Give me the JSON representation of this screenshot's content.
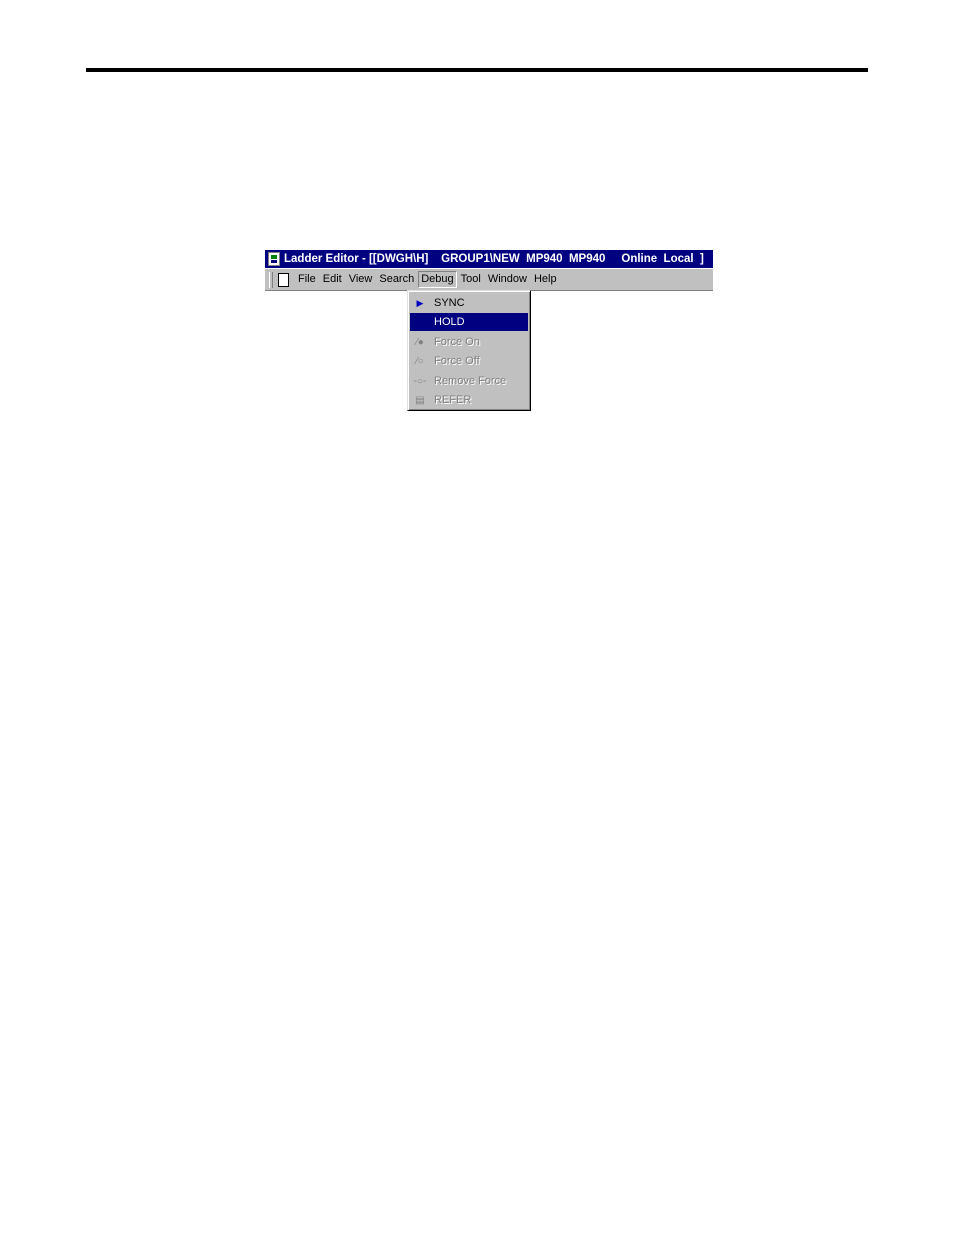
{
  "window": {
    "title": "Ladder Editor - [[DWGH\\H]    GROUP1\\NEW  MP940  MP940     Online  Local  ]"
  },
  "menubar": {
    "items": [
      {
        "label": "File"
      },
      {
        "label": "Edit"
      },
      {
        "label": "View"
      },
      {
        "label": "Search"
      },
      {
        "label": "Debug"
      },
      {
        "label": "Tool"
      },
      {
        "label": "Window"
      },
      {
        "label": "Help"
      }
    ]
  },
  "debug_menu": {
    "items": [
      {
        "label": "SYNC",
        "icon": "sync-icon",
        "state": "enabled"
      },
      {
        "label": "HOLD",
        "icon": "",
        "state": "selected"
      },
      {
        "label": "Force On",
        "icon": "force-on-icon",
        "state": "disabled"
      },
      {
        "label": "Force Off",
        "icon": "force-off-icon",
        "state": "disabled"
      },
      {
        "label": "Remove Force",
        "icon": "remove-force-icon",
        "state": "disabled"
      },
      {
        "label": "REFER",
        "icon": "refer-icon",
        "state": "disabled"
      }
    ]
  },
  "colors": {
    "titlebar": "#000080",
    "menu_face": "#c0c0c0",
    "selection": "#000080",
    "disabled_text": "#808080"
  }
}
